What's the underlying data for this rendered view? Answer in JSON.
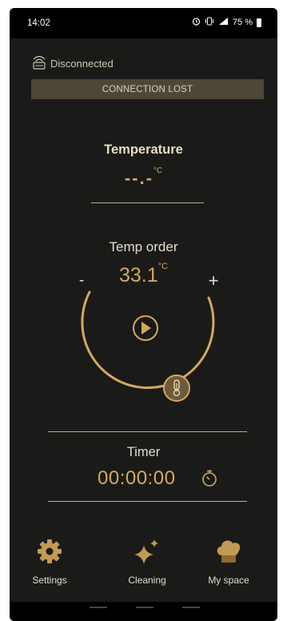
{
  "status_bar": {
    "time": "14:02",
    "battery": "75 %",
    "icons": [
      "alarm-icon",
      "vibrate-icon",
      "signal-icon",
      "battery-icon"
    ]
  },
  "connection": {
    "status": "Disconnected",
    "banner": "CONNECTION LOST"
  },
  "temperature": {
    "title": "Temperature",
    "value": "--.-",
    "unit": "°C"
  },
  "temp_order": {
    "title": "Temp order",
    "value": "33.1",
    "unit": "°C",
    "minus": "-",
    "plus": "+"
  },
  "timer": {
    "title": "Timer",
    "value": "00:00:00"
  },
  "bottom_nav": [
    {
      "label": "Settings",
      "icon": "gear-icon"
    },
    {
      "label": "Cleaning",
      "icon": "sparkle-icon"
    },
    {
      "label": "My space",
      "icon": "chef-hat-icon"
    }
  ],
  "colors": {
    "background": "#1a1a18",
    "accent": "#d4a862",
    "banner": "#4e4637",
    "text": "#e4dccc"
  }
}
